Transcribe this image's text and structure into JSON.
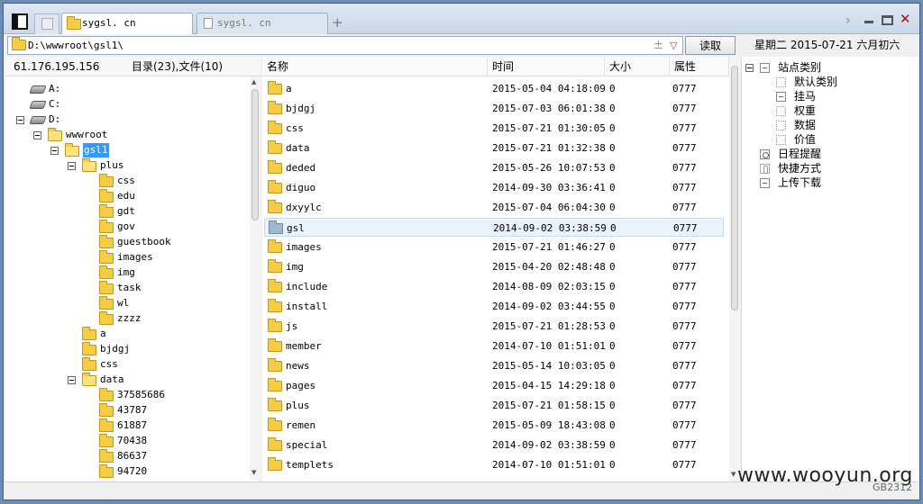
{
  "tabs": [
    {
      "label": "sygsl. cn",
      "active": true
    },
    {
      "label": "sygsl. cn",
      "active": false
    }
  ],
  "new_tab_glyph": "+",
  "window_controls": {
    "chevron": "›",
    "close": "✕"
  },
  "path": {
    "value": "D:\\wwwroot\\gsl1\\",
    "add_glyph": "±",
    "dropdown_glyph": "▽"
  },
  "read_button": "读取",
  "date_bar": "星期二 2015-07-21 六月初六",
  "left_panel": {
    "ip": "61.176.195.156",
    "counts": "目录(23),文件(10)"
  },
  "tree": [
    {
      "label": "A:",
      "level": 0,
      "kind": "drive",
      "expand": false
    },
    {
      "label": "C:",
      "level": 0,
      "kind": "drive",
      "expand": false
    },
    {
      "label": "D:",
      "level": 0,
      "kind": "drive",
      "expand": true
    },
    {
      "label": "wwwroot",
      "level": 1,
      "kind": "folder",
      "expand": true
    },
    {
      "label": "gsl1",
      "level": 2,
      "kind": "folder",
      "expand": true,
      "selected": true
    },
    {
      "label": "plus",
      "level": 3,
      "kind": "folder",
      "expand": true
    },
    {
      "label": "css",
      "level": 4,
      "kind": "folder",
      "expand": false
    },
    {
      "label": "edu",
      "level": 4,
      "kind": "folder",
      "expand": false
    },
    {
      "label": "gdt",
      "level": 4,
      "kind": "folder",
      "expand": false
    },
    {
      "label": "gov",
      "level": 4,
      "kind": "folder",
      "expand": false
    },
    {
      "label": "guestbook",
      "level": 4,
      "kind": "folder",
      "expand": false
    },
    {
      "label": "images",
      "level": 4,
      "kind": "folder",
      "expand": false
    },
    {
      "label": "img",
      "level": 4,
      "kind": "folder",
      "expand": false
    },
    {
      "label": "task",
      "level": 4,
      "kind": "folder",
      "expand": false
    },
    {
      "label": "wl",
      "level": 4,
      "kind": "folder",
      "expand": false
    },
    {
      "label": "zzzz",
      "level": 4,
      "kind": "folder",
      "expand": false
    },
    {
      "label": "a",
      "level": 3,
      "kind": "folder",
      "expand": false
    },
    {
      "label": "bjdgj",
      "level": 3,
      "kind": "folder",
      "expand": false
    },
    {
      "label": "css",
      "level": 3,
      "kind": "folder",
      "expand": false
    },
    {
      "label": "data",
      "level": 3,
      "kind": "folder",
      "expand": true
    },
    {
      "label": "37585686",
      "level": 4,
      "kind": "folder",
      "expand": false
    },
    {
      "label": "43787",
      "level": 4,
      "kind": "folder",
      "expand": false
    },
    {
      "label": "61887",
      "level": 4,
      "kind": "folder",
      "expand": false
    },
    {
      "label": "70438",
      "level": 4,
      "kind": "folder",
      "expand": false
    },
    {
      "label": "86637",
      "level": 4,
      "kind": "folder",
      "expand": false
    },
    {
      "label": "94720",
      "level": 4,
      "kind": "folder",
      "expand": false
    }
  ],
  "columns": [
    "名称",
    "时间",
    "大小",
    "属性"
  ],
  "files": [
    {
      "name": "a",
      "time": "2015-05-04 04:18:09",
      "size": "0",
      "attr": "0777"
    },
    {
      "name": "bjdgj",
      "time": "2015-07-03 06:01:38",
      "size": "0",
      "attr": "0777"
    },
    {
      "name": "css",
      "time": "2015-07-21 01:30:05",
      "size": "0",
      "attr": "0777"
    },
    {
      "name": "data",
      "time": "2015-07-21 01:32:38",
      "size": "0",
      "attr": "0777"
    },
    {
      "name": "deded",
      "time": "2015-05-26 10:07:53",
      "size": "0",
      "attr": "0777"
    },
    {
      "name": "diguo",
      "time": "2014-09-30 03:36:41",
      "size": "0",
      "attr": "0777"
    },
    {
      "name": "dxyylc",
      "time": "2015-07-04 06:04:30",
      "size": "0",
      "attr": "0777"
    },
    {
      "name": "gsl",
      "time": "2014-09-02 03:38:59",
      "size": "0",
      "attr": "0777",
      "selected": true
    },
    {
      "name": "images",
      "time": "2015-07-21 01:46:27",
      "size": "0",
      "attr": "0777"
    },
    {
      "name": "img",
      "time": "2015-04-20 02:48:48",
      "size": "0",
      "attr": "0777"
    },
    {
      "name": "include",
      "time": "2014-08-09 02:03:15",
      "size": "0",
      "attr": "0777"
    },
    {
      "name": "install",
      "time": "2014-09-02 03:44:55",
      "size": "0",
      "attr": "0777"
    },
    {
      "name": "js",
      "time": "2015-07-21 01:28:53",
      "size": "0",
      "attr": "0777"
    },
    {
      "name": "member",
      "time": "2014-07-10 01:51:01",
      "size": "0",
      "attr": "0777"
    },
    {
      "name": "news",
      "time": "2015-05-14 10:03:05",
      "size": "0",
      "attr": "0777"
    },
    {
      "name": "pages",
      "time": "2015-04-15 14:29:18",
      "size": "0",
      "attr": "0777"
    },
    {
      "name": "plus",
      "time": "2015-07-21 01:58:15",
      "size": "0",
      "attr": "0777"
    },
    {
      "name": "remen",
      "time": "2015-05-09 18:43:08",
      "size": "0",
      "attr": "0777"
    },
    {
      "name": "special",
      "time": "2014-09-02 03:38:59",
      "size": "0",
      "attr": "0777"
    },
    {
      "name": "templets",
      "time": "2014-07-10 01:51:01",
      "size": "0",
      "attr": "0777"
    }
  ],
  "right_tree": [
    {
      "label": "站点类别",
      "level": 0,
      "icon": "line",
      "expand": true
    },
    {
      "label": "默认类别",
      "level": 1,
      "icon": "dot"
    },
    {
      "label": "挂马",
      "level": 1,
      "icon": "line"
    },
    {
      "label": "权重",
      "level": 1,
      "icon": "dot"
    },
    {
      "label": "数据",
      "level": 1,
      "icon": "dot"
    },
    {
      "label": "价值",
      "level": 1,
      "icon": "dot"
    },
    {
      "label": "日程提醒",
      "level": 0,
      "icon": "clock"
    },
    {
      "label": "快捷方式",
      "level": 0,
      "icon": "hand"
    },
    {
      "label": "上传下载",
      "level": 0,
      "icon": "line"
    }
  ],
  "watermark": "www.wooyun.org",
  "watermark_id": "GB2312"
}
